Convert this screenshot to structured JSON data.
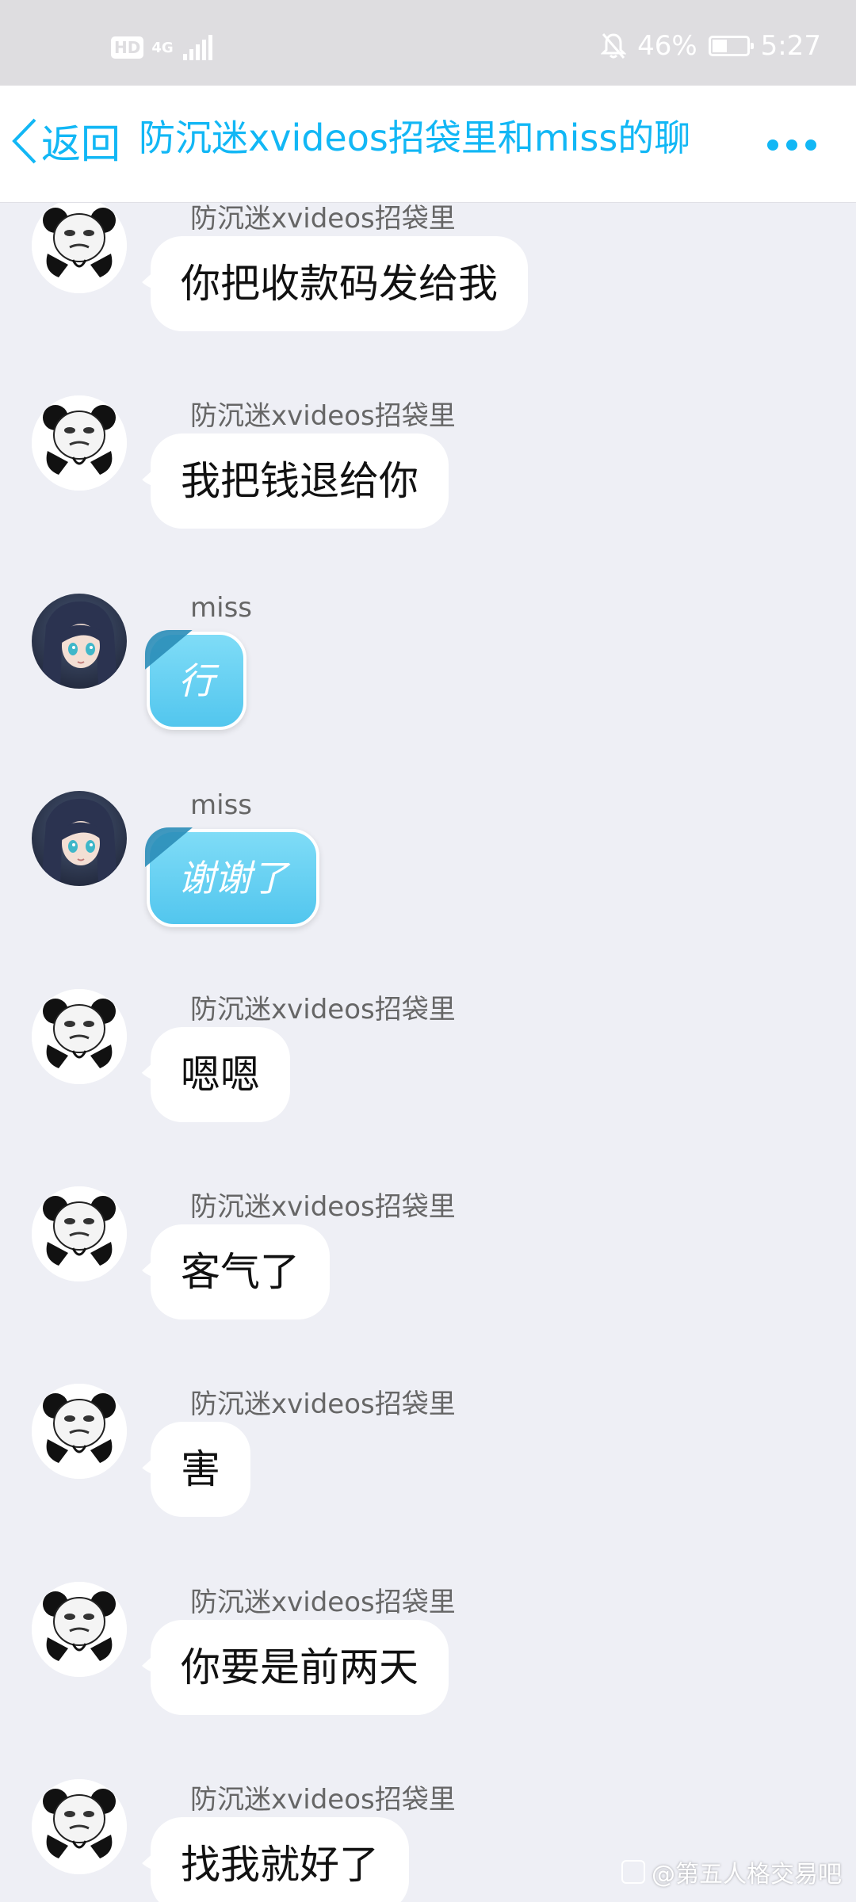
{
  "status_bar": {
    "hd": "HD",
    "network": "4G",
    "battery_percent_text": "46%",
    "battery_level": 0.46,
    "time": "5:27"
  },
  "header": {
    "back_label": "返回",
    "title": "防沉迷xvideos招袋里和miss的聊"
  },
  "messages": [
    {
      "sender": "防沉迷xvideos招袋里",
      "text": "你把收款码发给我",
      "avatar": "panda-meme",
      "style": "white"
    },
    {
      "sender": "防沉迷xvideos招袋里",
      "text": "我把钱退给你",
      "avatar": "panda-meme",
      "style": "white"
    },
    {
      "sender": "miss",
      "text": "行",
      "avatar": "anime-girl",
      "style": "blue"
    },
    {
      "sender": "miss",
      "text": "谢谢了",
      "avatar": "anime-girl",
      "style": "blue"
    },
    {
      "sender": "防沉迷xvideos招袋里",
      "text": "嗯嗯",
      "avatar": "panda-meme",
      "style": "white"
    },
    {
      "sender": "防沉迷xvideos招袋里",
      "text": "客气了",
      "avatar": "panda-meme",
      "style": "white"
    },
    {
      "sender": "防沉迷xvideos招袋里",
      "text": "害",
      "avatar": "panda-meme",
      "style": "white"
    },
    {
      "sender": "防沉迷xvideos招袋里",
      "text": "你要是前两天",
      "avatar": "panda-meme",
      "style": "white"
    },
    {
      "sender": "防沉迷xvideos招袋里",
      "text": "找我就好了",
      "avatar": "panda-meme",
      "style": "white"
    }
  ],
  "watermark": "@第五人格交易吧",
  "colors": {
    "accent": "#12b7f5",
    "background": "#eeeff5",
    "blue_bubble": "#5bcaf0"
  }
}
